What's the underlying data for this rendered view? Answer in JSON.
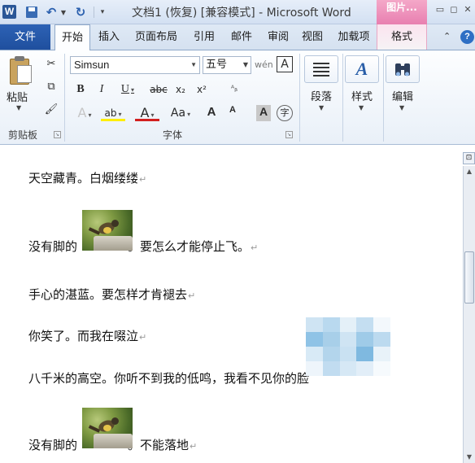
{
  "titlebar": {
    "app_icon_letter": "W",
    "title": "文档1 (恢复) [兼容模式] - Microsoft Word",
    "context_group": "图片...",
    "min_glyph": "▭",
    "restore_glyph": "◻",
    "close_glyph": "✕",
    "undo_glyph": "↶",
    "redo_glyph": "↻"
  },
  "tabs": {
    "file": "文件",
    "items": [
      "开始",
      "插入",
      "页面布局",
      "引用",
      "邮件",
      "审阅",
      "视图",
      "加载项",
      "格式"
    ],
    "active_index": 0,
    "help": "?"
  },
  "ribbon": {
    "clipboard": {
      "paste": "粘贴",
      "label": "剪贴板"
    },
    "font": {
      "font_name": "Simsun",
      "font_size": "五号",
      "label": "字体",
      "bold": "B",
      "italic": "I",
      "underline": "U",
      "strike": "abc",
      "subscript": "x₂",
      "superscript": "x²",
      "grow": "A",
      "shrink": "A",
      "case": "Aa",
      "pinyin": "wén",
      "border_char": "A",
      "enclose": "字",
      "text_effect": "A",
      "highlight": "ab",
      "color": "A",
      "shade": "A",
      "circle_char": "字"
    },
    "paragraph": {
      "label": "段落"
    },
    "styles": {
      "label": "样式"
    },
    "editing": {
      "label": "编辑"
    }
  },
  "document": {
    "paragraphs": [
      {
        "text": "天空藏青。白烟缕缕",
        "mark": "↵"
      },
      {
        "before": "没有脚的",
        "after": "。要怎么才能停止飞。",
        "mark": "↵"
      },
      {
        "text": "手心的湛蓝。要怎样才肯褪去",
        "mark": "↵"
      },
      {
        "text": "你笑了。而我在啜泣",
        "mark": "↵"
      },
      {
        "text": "八千米的高空。你听不到我的低鸣，我看不见你的脸",
        "mark": "↵"
      },
      {
        "before": "没有脚的",
        "after": "。不能落地",
        "mark": "↵"
      }
    ]
  },
  "colors": {
    "file_tab": "#2d62b5",
    "context_tab": "#e87fb0",
    "highlight_yellow": "#ffee00",
    "font_color_red": "#d21f1f"
  }
}
